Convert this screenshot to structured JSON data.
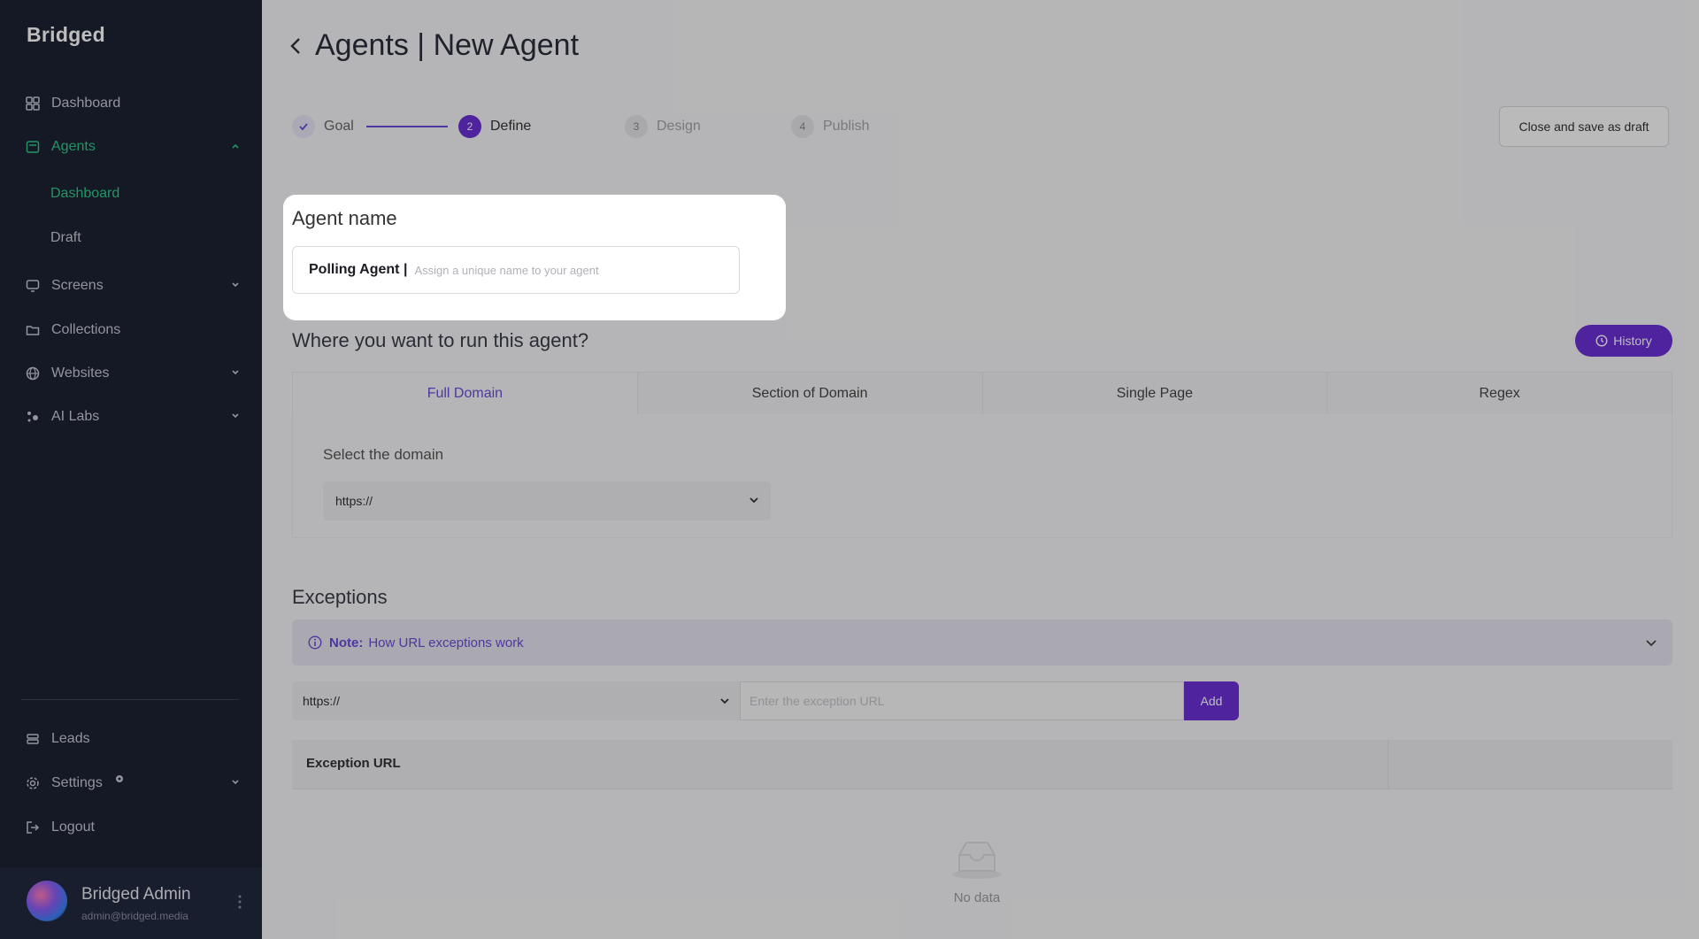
{
  "app": {
    "logo": "Bridged"
  },
  "sidebar": {
    "items": [
      {
        "label": "Dashboard",
        "icon": "grid-icon"
      },
      {
        "label": "Agents",
        "icon": "agent-icon"
      },
      {
        "label": "Screens",
        "icon": "screen-icon"
      },
      {
        "label": "Collections",
        "icon": "folder-icon"
      },
      {
        "label": "Websites",
        "icon": "globe-icon"
      },
      {
        "label": "AI Labs",
        "icon": "sparkle-icon"
      },
      {
        "label": "Leads",
        "icon": "leads-icon"
      },
      {
        "label": "Settings",
        "icon": "gear-icon"
      },
      {
        "label": "Logout",
        "icon": "logout-icon"
      }
    ],
    "agents_sub": [
      {
        "label": "Dashboard"
      },
      {
        "label": "Draft"
      }
    ],
    "user": {
      "name": "Bridged Admin",
      "email": "admin@bridged.media"
    }
  },
  "header": {
    "title": "Agents | New Agent"
  },
  "stepper": {
    "steps": [
      {
        "number": "",
        "label": "Goal",
        "state": "done"
      },
      {
        "number": "2",
        "label": "Define",
        "state": "current"
      },
      {
        "number": "3",
        "label": "Design",
        "state": "todo"
      },
      {
        "number": "4",
        "label": "Publish",
        "state": "todo"
      }
    ],
    "draft_button": "Close and save as draft"
  },
  "agent_name": {
    "label": "Agent name",
    "value": "Polling Agent |",
    "placeholder": "Assign a unique name to your agent"
  },
  "run_location": {
    "title": "Where you want to run this agent?",
    "history_button": "History",
    "tabs": [
      "Full Domain",
      "Section of Domain",
      "Single Page",
      "Regex"
    ],
    "active_tab": "Full Domain",
    "domain_label": "Select the domain",
    "domain_value": "https://"
  },
  "exceptions": {
    "title": "Exceptions",
    "note_label": "Note:",
    "note_link": "How URL exceptions work",
    "protocol_value": "https://",
    "url_placeholder": "Enter the exception URL",
    "add_button": "Add",
    "table_header": "Exception URL",
    "empty_text": "No data"
  },
  "colors": {
    "accent": "#6b2fd6",
    "sidebar_bg": "#1d2233",
    "active_green": "#2ec986"
  }
}
